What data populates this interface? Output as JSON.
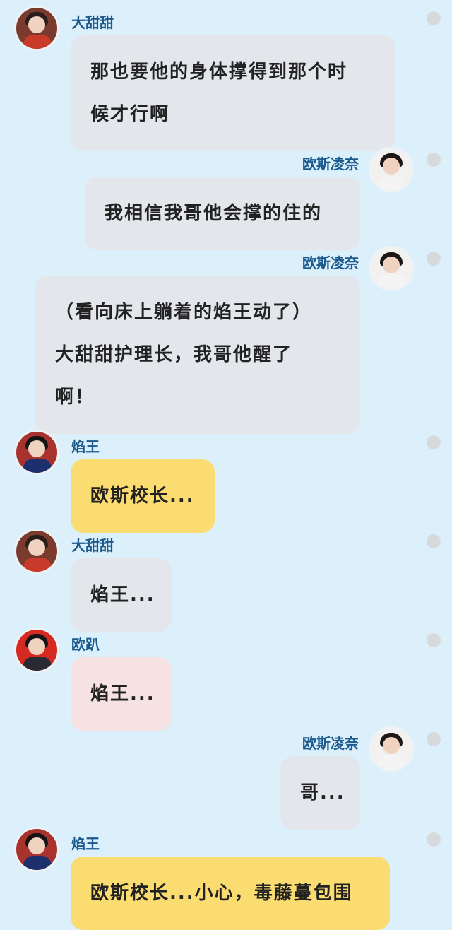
{
  "colors": {
    "background": "#dcf0fb",
    "name_text": "#1b5a8e",
    "bubble_gray": "#e3e6ea",
    "bubble_yellow": "#fbdc70",
    "bubble_pink": "#f6e1e3",
    "menu_dot": "#d6dadd"
  },
  "messages": [
    {
      "side": "left",
      "name": "大甜甜",
      "avatar": "avatar-datiantian",
      "bubble_color": "gray",
      "lines": [
        "那也要他的身体撑得到那个时",
        "候才行啊"
      ]
    },
    {
      "side": "right",
      "name": "欧斯凌奈",
      "avatar": "avatar-ousilingnai",
      "bubble_color": "gray",
      "lines": [
        "我相信我哥他会撑的住的"
      ]
    },
    {
      "side": "right",
      "name": "欧斯凌奈",
      "avatar": "avatar-ousilingnai",
      "bubble_color": "gray",
      "lines": [
        "（看向床上躺着的焰王动了）",
        "大甜甜护理长，我哥他醒了",
        "啊！"
      ]
    },
    {
      "side": "left",
      "name": "焰王",
      "avatar": "avatar-yanwang",
      "bubble_color": "yellow",
      "lines": [
        "欧斯校长..."
      ]
    },
    {
      "side": "left",
      "name": "大甜甜",
      "avatar": "avatar-datiantian",
      "bubble_color": "gray",
      "lines": [
        "焰王..."
      ]
    },
    {
      "side": "left",
      "name": "欧趴",
      "avatar": "avatar-oupa",
      "bubble_color": "pink",
      "lines": [
        "焰王..."
      ]
    },
    {
      "side": "right",
      "name": "欧斯凌奈",
      "avatar": "avatar-ousilingnai",
      "bubble_color": "gray",
      "lines": [
        "哥..."
      ]
    },
    {
      "side": "left",
      "name": "焰王",
      "avatar": "avatar-yanwang",
      "bubble_color": "yellow",
      "lines": [
        "欧斯校长...小心，毒藤蔓包围"
      ]
    }
  ]
}
